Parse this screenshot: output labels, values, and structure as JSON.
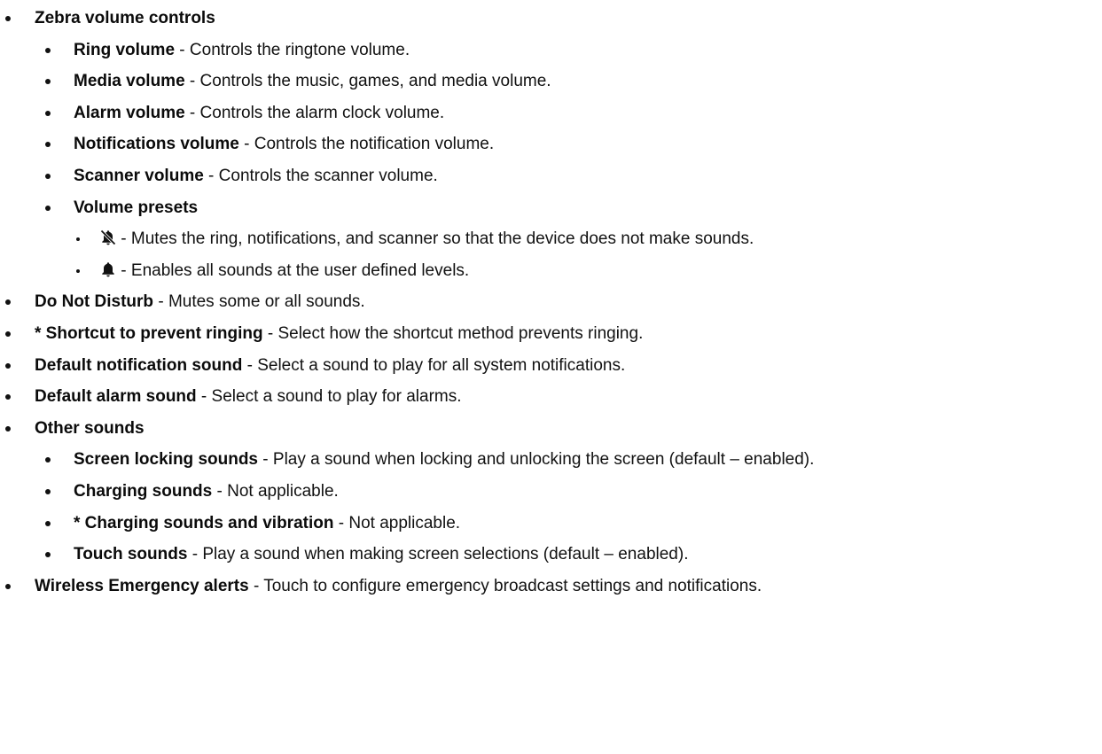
{
  "sections": [
    {
      "heading": "Zebra volume controls",
      "items": [
        {
          "term": "Ring volume",
          "desc": "Controls the ringtone volume."
        },
        {
          "term": "Media volume",
          "desc": "Controls the music, games, and media volume."
        },
        {
          "term": "Alarm volume",
          "desc": "Controls the alarm clock volume."
        },
        {
          "term": "Notifications volume",
          "desc": "Controls the notification volume."
        },
        {
          "term": "Scanner volume",
          "desc": "Controls the scanner volume."
        }
      ],
      "presets": {
        "heading": "Volume presets",
        "items": [
          {
            "icon": "bell-off-icon",
            "desc": "Mutes the ring, notifications, and scanner so that the device does not make sounds."
          },
          {
            "icon": "bell-icon",
            "desc": "Enables all sounds at the user defined levels."
          }
        ]
      }
    }
  ],
  "top_items": [
    {
      "term": "Do Not Disturb",
      "desc": "Mutes some or all sounds."
    },
    {
      "term": "* Shortcut to prevent ringing",
      "desc": "Select how the shortcut method prevents ringing."
    },
    {
      "term": "Default notification sound",
      "desc": "Select a sound to play for all system notifications."
    },
    {
      "term": "Default alarm sound",
      "desc": "Select a sound to play for alarms."
    }
  ],
  "other_sounds": {
    "heading": "Other sounds",
    "items": [
      {
        "term": "Screen locking sounds",
        "desc": "Play a sound when locking and unlocking the screen (default – enabled)."
      },
      {
        "term": "Charging sounds",
        "desc": "Not applicable."
      },
      {
        "term": "* Charging sounds and vibration",
        "desc": "Not applicable."
      },
      {
        "term": "Touch sounds",
        "desc": "Play a sound when making screen selections (default – enabled)."
      }
    ]
  },
  "last_item": {
    "term": "Wireless Emergency alerts",
    "desc": "Touch to configure emergency broadcast settings and notifications."
  },
  "separator": " - "
}
